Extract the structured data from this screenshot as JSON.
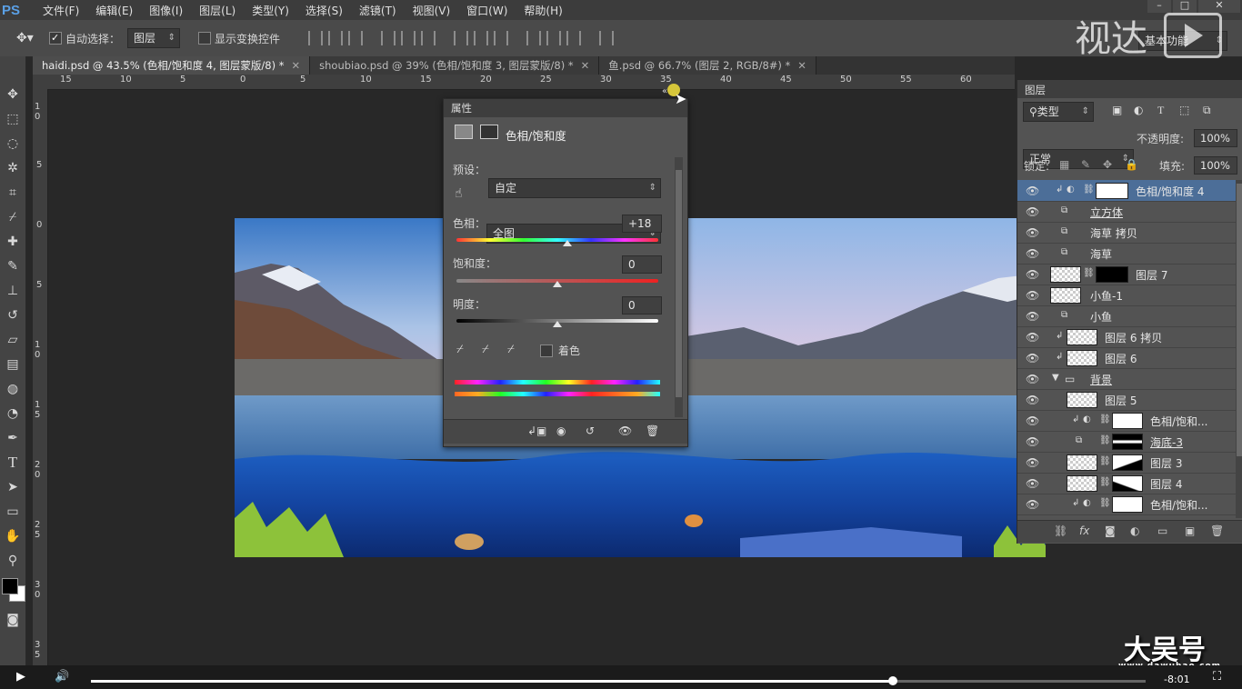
{
  "app": {
    "logo": "PS"
  },
  "menu": [
    "文件(F)",
    "编辑(E)",
    "图像(I)",
    "图层(L)",
    "类型(Y)",
    "选择(S)",
    "滤镜(T)",
    "视图(V)",
    "窗口(W)",
    "帮助(H)"
  ],
  "options_bar": {
    "auto_select_label": "自动选择：",
    "auto_select_checked": true,
    "auto_select_target": "图层",
    "show_transform_label": "显示变换控件",
    "show_transform_checked": false,
    "workspace": "基本功能"
  },
  "watermark_top": "视达",
  "watermark_bottom": "大吴号",
  "watermark_url": "www.dawuhao.com",
  "tabs": [
    {
      "label": "haidi.psd @ 43.5% (色相/饱和度 4, 图层蒙版/8) *",
      "active": true
    },
    {
      "label": "shoubiao.psd @ 39% (色相/饱和度 3, 图层蒙版/8) *",
      "active": false
    },
    {
      "label": "鱼.psd @ 66.7% (图层 2, RGB/8#) *",
      "active": false
    }
  ],
  "hruler_labels": [
    "15",
    "10",
    "5",
    "0",
    "5",
    "10",
    "15",
    "20",
    "25",
    "30",
    "35",
    "40",
    "45",
    "50",
    "55",
    "60"
  ],
  "vruler_labels": [
    "1 0",
    "5",
    "0",
    "5",
    "1 0",
    "1 5",
    "2 0",
    "2 5",
    "3 0",
    "3 5"
  ],
  "properties": {
    "panel_title": "属性",
    "adjustment_name": "色相/饱和度",
    "preset_label": "预设：",
    "preset_value": "自定",
    "channel_value": "全图",
    "hue_label": "色相：",
    "hue_value": "+18",
    "hue_level": 0.55,
    "saturation_label": "饱和度：",
    "saturation_value": "0",
    "saturation_level": 0.5,
    "lightness_label": "明度：",
    "lightness_value": "0",
    "lightness_level": 0.5,
    "colorize_label": "着色",
    "colorize_checked": false
  },
  "layers": {
    "panel_title": "图层",
    "filter_label": "类型",
    "blend_mode": "正常",
    "opacity_label": "不透明度:",
    "opacity_value": "100%",
    "lock_label": "锁定:",
    "fill_label": "填充:",
    "fill_value": "100%",
    "items": [
      {
        "name": "色相/饱和度 4",
        "selected": true
      },
      {
        "name": "立方体"
      },
      {
        "name": "海草 拷贝"
      },
      {
        "name": "海草"
      },
      {
        "name": "图层 7"
      },
      {
        "name": "小鱼-1"
      },
      {
        "name": "小鱼"
      },
      {
        "name": "图层 6 拷贝"
      },
      {
        "name": "图层 6"
      },
      {
        "name": "背景"
      },
      {
        "name": "图层 5"
      },
      {
        "name": "色相/饱和..."
      },
      {
        "name": "海底-3"
      },
      {
        "name": "图层 3"
      },
      {
        "name": "图层 4"
      },
      {
        "name": "色相/饱和..."
      }
    ]
  },
  "video": {
    "time": "-8:01",
    "progress": 0.76
  }
}
